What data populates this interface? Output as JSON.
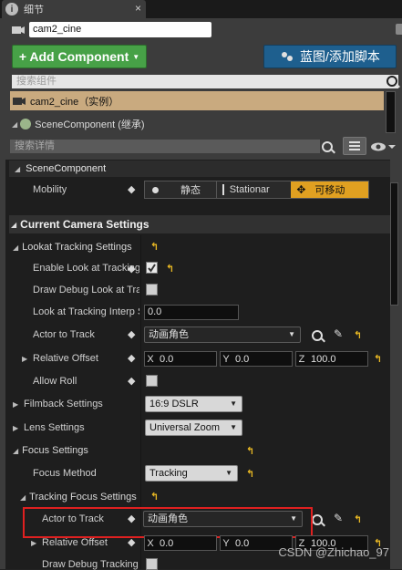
{
  "tab": {
    "icon": "info-icon",
    "title": "细节",
    "close": "×"
  },
  "component_name": "cam2_cine",
  "toolbar": {
    "add_component": "+ Add Component",
    "blueprint": "蓝图/添加脚本"
  },
  "search_components_placeholder": "搜索组件",
  "tree": {
    "selected": "cam2_cine（实例）",
    "child": "SceneComponent (继承)"
  },
  "search_details_placeholder": "搜索详情",
  "scene_component": {
    "header": "SceneComponent",
    "mobility_label": "Mobility",
    "mobility_options": [
      "静态",
      "Stationar",
      "可移动"
    ],
    "mobility_selected": "可移动"
  },
  "camera_settings": {
    "header": "Current Camera Settings",
    "lookat": {
      "header": "Lookat Tracking Settings",
      "enable_label": "Enable Look at Tracking",
      "enable_checked": true,
      "draw_debug_label": "Draw Debug Look at Tracking",
      "interp_label": "Look at Tracking Interp Speed",
      "interp_value": "0.0",
      "actor_label": "Actor to Track",
      "actor_value": "动画角色",
      "offset_label": "Relative Offset",
      "offset": {
        "x": "0.0",
        "y": "0.0",
        "z": "100.0"
      },
      "allow_roll_label": "Allow Roll"
    },
    "filmback": {
      "label": "Filmback Settings",
      "value": "16:9 DSLR"
    },
    "lens": {
      "label": "Lens Settings",
      "value": "Universal Zoom"
    },
    "focus": {
      "header": "Focus Settings",
      "method_label": "Focus Method",
      "method_value": "Tracking",
      "tracking_header": "Tracking Focus Settings",
      "actor_label": "Actor to Track",
      "actor_value": "动画角色",
      "offset_label": "Relative Offset",
      "offset": {
        "x": "0.0",
        "y": "0.0",
        "z": "100.0"
      },
      "draw_debug_label": "Draw Debug Tracking"
    }
  },
  "axis_labels": {
    "x": "X",
    "y": "Y",
    "z": "Z"
  },
  "watermark": "CSDN @Zhichao_97",
  "colors": {
    "add_button": "#47a147",
    "blueprint_button": "#1e5f8e",
    "selected_row": "#c9aa7f",
    "highlight_box": "#e02020",
    "reset_arrow": "#e8b823"
  }
}
